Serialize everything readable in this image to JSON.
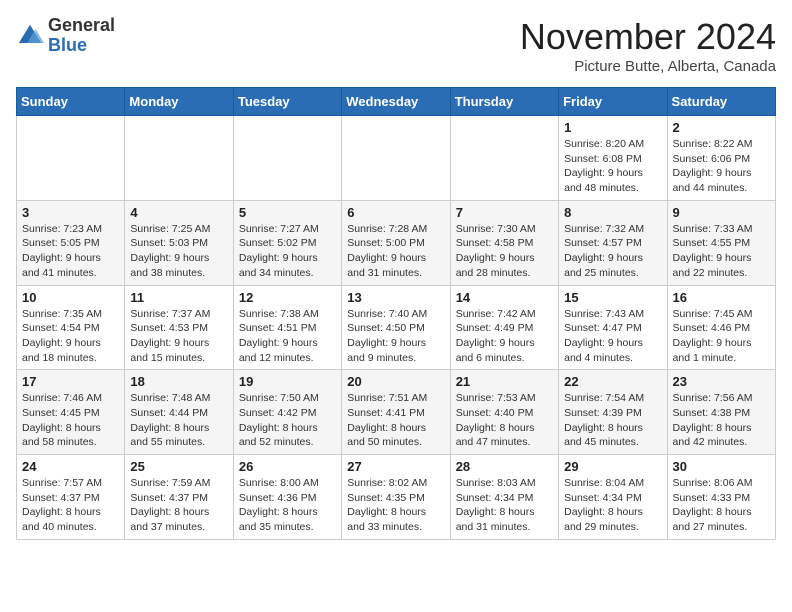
{
  "logo": {
    "general": "General",
    "blue": "Blue"
  },
  "title": "November 2024",
  "location": "Picture Butte, Alberta, Canada",
  "weekdays": [
    "Sunday",
    "Monday",
    "Tuesday",
    "Wednesday",
    "Thursday",
    "Friday",
    "Saturday"
  ],
  "weeks": [
    [
      {
        "day": "",
        "info": ""
      },
      {
        "day": "",
        "info": ""
      },
      {
        "day": "",
        "info": ""
      },
      {
        "day": "",
        "info": ""
      },
      {
        "day": "",
        "info": ""
      },
      {
        "day": "1",
        "info": "Sunrise: 8:20 AM\nSunset: 6:08 PM\nDaylight: 9 hours and 48 minutes."
      },
      {
        "day": "2",
        "info": "Sunrise: 8:22 AM\nSunset: 6:06 PM\nDaylight: 9 hours and 44 minutes."
      }
    ],
    [
      {
        "day": "3",
        "info": "Sunrise: 7:23 AM\nSunset: 5:05 PM\nDaylight: 9 hours and 41 minutes."
      },
      {
        "day": "4",
        "info": "Sunrise: 7:25 AM\nSunset: 5:03 PM\nDaylight: 9 hours and 38 minutes."
      },
      {
        "day": "5",
        "info": "Sunrise: 7:27 AM\nSunset: 5:02 PM\nDaylight: 9 hours and 34 minutes."
      },
      {
        "day": "6",
        "info": "Sunrise: 7:28 AM\nSunset: 5:00 PM\nDaylight: 9 hours and 31 minutes."
      },
      {
        "day": "7",
        "info": "Sunrise: 7:30 AM\nSunset: 4:58 PM\nDaylight: 9 hours and 28 minutes."
      },
      {
        "day": "8",
        "info": "Sunrise: 7:32 AM\nSunset: 4:57 PM\nDaylight: 9 hours and 25 minutes."
      },
      {
        "day": "9",
        "info": "Sunrise: 7:33 AM\nSunset: 4:55 PM\nDaylight: 9 hours and 22 minutes."
      }
    ],
    [
      {
        "day": "10",
        "info": "Sunrise: 7:35 AM\nSunset: 4:54 PM\nDaylight: 9 hours and 18 minutes."
      },
      {
        "day": "11",
        "info": "Sunrise: 7:37 AM\nSunset: 4:53 PM\nDaylight: 9 hours and 15 minutes."
      },
      {
        "day": "12",
        "info": "Sunrise: 7:38 AM\nSunset: 4:51 PM\nDaylight: 9 hours and 12 minutes."
      },
      {
        "day": "13",
        "info": "Sunrise: 7:40 AM\nSunset: 4:50 PM\nDaylight: 9 hours and 9 minutes."
      },
      {
        "day": "14",
        "info": "Sunrise: 7:42 AM\nSunset: 4:49 PM\nDaylight: 9 hours and 6 minutes."
      },
      {
        "day": "15",
        "info": "Sunrise: 7:43 AM\nSunset: 4:47 PM\nDaylight: 9 hours and 4 minutes."
      },
      {
        "day": "16",
        "info": "Sunrise: 7:45 AM\nSunset: 4:46 PM\nDaylight: 9 hours and 1 minute."
      }
    ],
    [
      {
        "day": "17",
        "info": "Sunrise: 7:46 AM\nSunset: 4:45 PM\nDaylight: 8 hours and 58 minutes."
      },
      {
        "day": "18",
        "info": "Sunrise: 7:48 AM\nSunset: 4:44 PM\nDaylight: 8 hours and 55 minutes."
      },
      {
        "day": "19",
        "info": "Sunrise: 7:50 AM\nSunset: 4:42 PM\nDaylight: 8 hours and 52 minutes."
      },
      {
        "day": "20",
        "info": "Sunrise: 7:51 AM\nSunset: 4:41 PM\nDaylight: 8 hours and 50 minutes."
      },
      {
        "day": "21",
        "info": "Sunrise: 7:53 AM\nSunset: 4:40 PM\nDaylight: 8 hours and 47 minutes."
      },
      {
        "day": "22",
        "info": "Sunrise: 7:54 AM\nSunset: 4:39 PM\nDaylight: 8 hours and 45 minutes."
      },
      {
        "day": "23",
        "info": "Sunrise: 7:56 AM\nSunset: 4:38 PM\nDaylight: 8 hours and 42 minutes."
      }
    ],
    [
      {
        "day": "24",
        "info": "Sunrise: 7:57 AM\nSunset: 4:37 PM\nDaylight: 8 hours and 40 minutes."
      },
      {
        "day": "25",
        "info": "Sunrise: 7:59 AM\nSunset: 4:37 PM\nDaylight: 8 hours and 37 minutes."
      },
      {
        "day": "26",
        "info": "Sunrise: 8:00 AM\nSunset: 4:36 PM\nDaylight: 8 hours and 35 minutes."
      },
      {
        "day": "27",
        "info": "Sunrise: 8:02 AM\nSunset: 4:35 PM\nDaylight: 8 hours and 33 minutes."
      },
      {
        "day": "28",
        "info": "Sunrise: 8:03 AM\nSunset: 4:34 PM\nDaylight: 8 hours and 31 minutes."
      },
      {
        "day": "29",
        "info": "Sunrise: 8:04 AM\nSunset: 4:34 PM\nDaylight: 8 hours and 29 minutes."
      },
      {
        "day": "30",
        "info": "Sunrise: 8:06 AM\nSunset: 4:33 PM\nDaylight: 8 hours and 27 minutes."
      }
    ]
  ]
}
